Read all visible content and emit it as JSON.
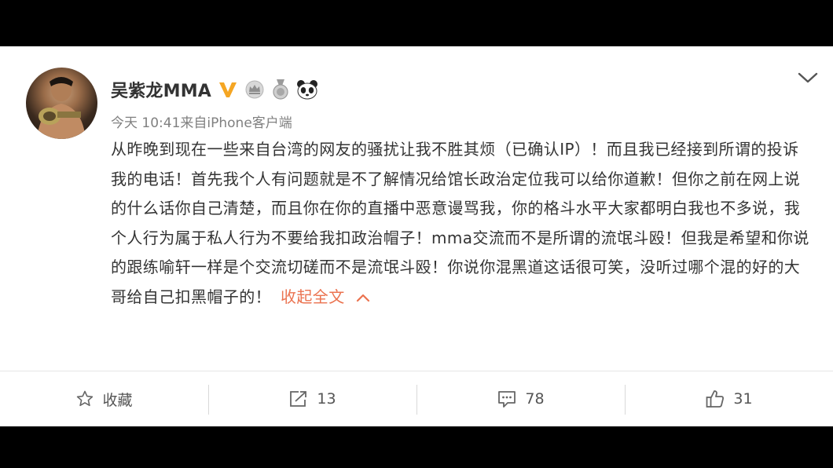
{
  "post": {
    "author": "吴紫龙MMA",
    "time": "今天 10:41",
    "source": "来自iPhone客户端",
    "text": "从昨晚到现在一些来自台湾的网友的骚扰让我不胜其烦（已确认IP）！而且我已经接到所谓的投诉我的电话！首先我个人有问题就是不了解情况给馆长政治定位我可以给你道歉！但你之前在网上说的什么话你自己清楚，而且你在你的直播中恶意谩骂我，你的格斗水平大家都明白我也不多说，我个人行为属于私人行为不要给我扣政治帽子！mma交流而不是所谓的流氓斗殴！但我是希望和你说的跟练喻轩一样是个交流切磋而不是流氓斗殴！你说你混黑道这话很可笑，没听过哪个混的好的大哥给自己扣黑帽子的！",
    "collapse_label": "收起全文",
    "accent_color": "#eb7350",
    "verified_color": "#f5a623"
  },
  "actions": {
    "favorite_label": "收藏",
    "repost_count": "13",
    "comment_count": "78",
    "like_count": "31"
  },
  "icons": [
    "verified-v-icon",
    "crown-icon",
    "medal-icon",
    "panda-icon",
    "chevron-down-icon",
    "star-icon",
    "repost-icon",
    "comment-icon",
    "thumbs-up-icon",
    "chevron-up-icon"
  ]
}
